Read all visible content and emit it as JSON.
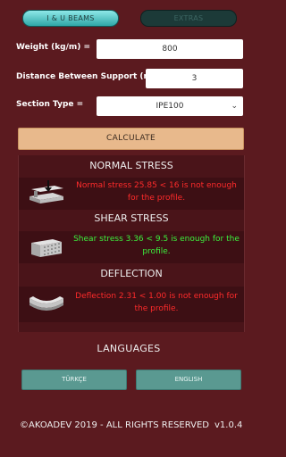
{
  "tabs": {
    "active": "I & U BEAMS",
    "inactive": "EXTRAS"
  },
  "form": {
    "weight_label": "Weight (kg/m) =",
    "weight_value": "800",
    "distance_label": "Distance Between Support (m) =",
    "distance_value": "3",
    "section_label": "Section Type =",
    "section_value": "IPE100"
  },
  "calculate_label": "CALCULATE",
  "results": {
    "normal": {
      "title": "NORMAL STRESS",
      "line1": "Normal stress 25.85 < 16 is not enough",
      "line2": "for the profile.",
      "color": "red"
    },
    "shear": {
      "title": "SHEAR STRESS",
      "line1": "Shear stress 3.36 < 9.5 is enough for the",
      "line2": "profile.",
      "color": "green"
    },
    "deflection": {
      "title": "DEFLECTION",
      "line1": "Deflection 2.31 < 1.00 is not enough for",
      "line2": "the profile.",
      "color": "red"
    }
  },
  "languages": {
    "title": "LANGUAGES",
    "turkish": "TÜRKÇE",
    "english": "ENGLISH"
  },
  "footer": {
    "copyright": "©AKOADEV 2019 - ALL RIGHTS RESERVED",
    "version": "v1.0.4"
  }
}
